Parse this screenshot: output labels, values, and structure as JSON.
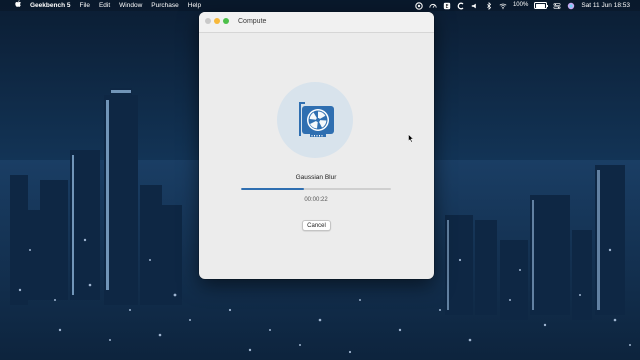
{
  "menubar": {
    "app_name": "Geekbench 5",
    "items": [
      "File",
      "Edit",
      "Window",
      "Purchase",
      "Help"
    ],
    "battery_percent": "100%",
    "datetime": "Sat 11 Jun  18:53"
  },
  "window": {
    "title": "Compute",
    "task": "Gaussian Blur",
    "progress": 0.42,
    "elapsed": "00:00:22",
    "cancel_label": "Cancel"
  },
  "colors": {
    "accent": "#2f6fb1",
    "icon_blue": "#2f6fb1",
    "badge_bg": "#d8e3ec"
  },
  "icons": {
    "gpu": "gpu-card-icon",
    "apple": "apple-logo-icon"
  }
}
